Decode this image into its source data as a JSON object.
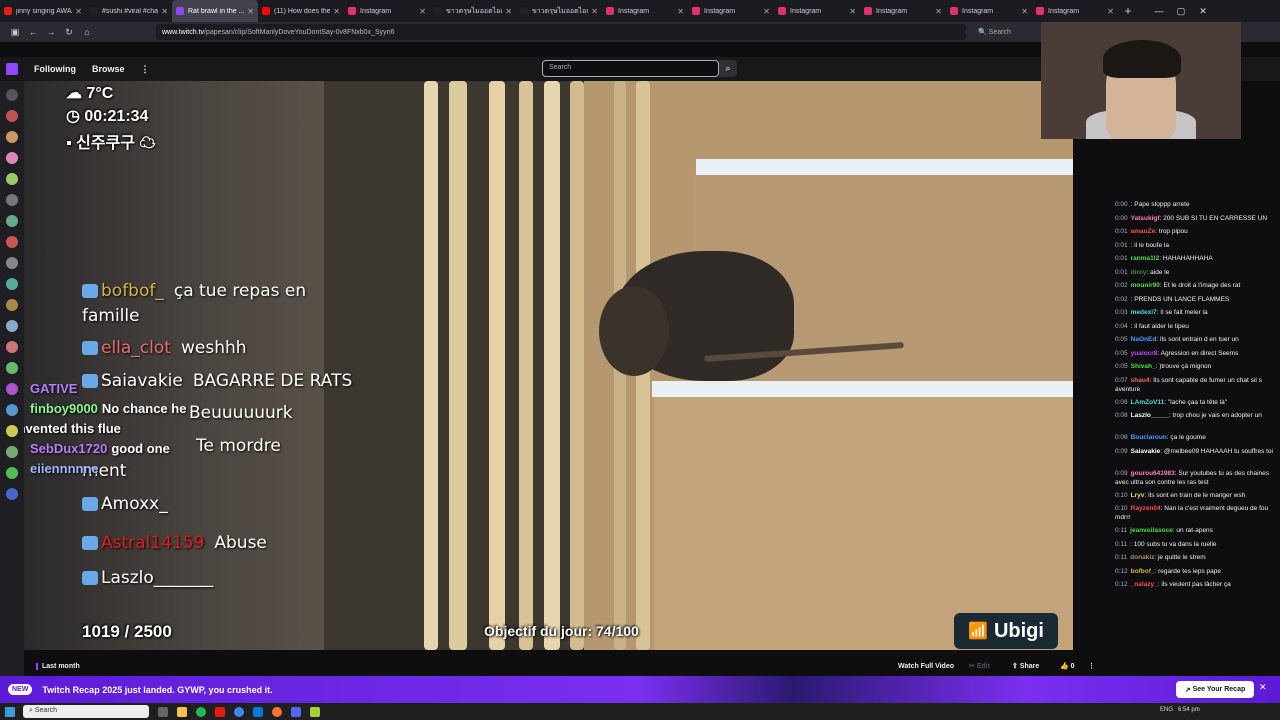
{
  "browser": {
    "tabs": [
      {
        "title": "jinny singing AWAA ...",
        "color": "#e91916",
        "active": false
      },
      {
        "title": "#sushi #viral #challen...",
        "color": "#222222",
        "active": false
      },
      {
        "title": "Rat brawl in the ...",
        "color": "#9147ff",
        "active": true
      },
      {
        "title": "(11) How does the 8...",
        "color": "#ff0000",
        "active": false
      },
      {
        "title": "Instagram",
        "color": "#e1306c",
        "active": false
      },
      {
        "title": "ขาวตรุษไมออดไอเอ ฟลอดี...",
        "color": "#222222",
        "active": false
      },
      {
        "title": "ขาวตรุษไมออดไอเอ ฟลอดี...",
        "color": "#222222",
        "active": false
      },
      {
        "title": "Instagram",
        "color": "#e1306c",
        "active": false
      },
      {
        "title": "Instagram",
        "color": "#e1306c",
        "active": false
      },
      {
        "title": "Instagram",
        "color": "#e1306c",
        "active": false
      },
      {
        "title": "Instagram",
        "color": "#e1306c",
        "active": false
      },
      {
        "title": "Instagram",
        "color": "#e1306c",
        "active": false
      },
      {
        "title": "Instagram",
        "color": "#e1306c",
        "active": false
      }
    ],
    "url_host": "www.twitch.tv",
    "url_path": "/papesan/clip/SoftManlyDoveYouDontSay-0v8FNxb0x_Syyn6",
    "search_placeholder": "Search"
  },
  "twitch": {
    "nav_following": "Following",
    "nav_browse": "Browse",
    "nav_more": "⋮",
    "search_placeholder": "Search"
  },
  "overlay": {
    "weather": "7°C",
    "time": "00:21:34",
    "location": "신주쿠구",
    "counter": "1019 / 2500",
    "goal": "Objectif du jour: 74/100",
    "sponsor": "Ubigi",
    "stream_chat": [
      {
        "user": "bofbof_",
        "msg": "ça tue repas en",
        "color": "#d4b14c"
      },
      {
        "user": "",
        "msg": "famille",
        "color": "#ffffff"
      },
      {
        "user": "ella_clot",
        "msg": "weshhh",
        "color": "#e86a6a"
      },
      {
        "user": "Saiavakie",
        "msg": "BAGARRE DE RATS",
        "color": "#ffffff"
      },
      {
        "user": "",
        "msg": "Beuuuuuurk",
        "color": "#ffffff"
      },
      {
        "user": "",
        "msg": "Te mordre",
        "color": "#ffffff"
      },
      {
        "user": "",
        "msg": "ment",
        "color": "#ffffff"
      },
      {
        "user": "Amoxx_",
        "msg": "",
        "color": "#ffffff"
      },
      {
        "user": "Astral14159",
        "msg": "Abuse",
        "color": "#e21b1b"
      },
      {
        "user": "Laszlo_______",
        "msg": "",
        "color": "#ffffff"
      }
    ],
    "left_chat": [
      {
        "user": "GATIVE",
        "msg": "",
        "color": "#b77cff"
      },
      {
        "user": "finboy9000",
        "msg": "No chance he",
        "color": "#8ef58e"
      },
      {
        "user": "",
        "msg": "invented this flue",
        "color": "#ffffff"
      },
      {
        "user": "SebDux1720",
        "msg": "good one",
        "color": "#b77cff"
      },
      {
        "user": "eiiennnnne",
        "msg": "",
        "color": "#9fb7ff"
      }
    ]
  },
  "chat": {
    "messages": [
      {
        "t": "0:00",
        "u": "",
        "m": ": Pape stoppp arrete",
        "c": "#5a5aff"
      },
      {
        "t": "0:00",
        "u": "Yatsukigf",
        "m": ": 200 SUB SI TU EN CARRESSE UN",
        "c": "#ff7fbf"
      },
      {
        "t": "0:01",
        "u": "amauZe",
        "m": ": trop pipou",
        "c": "#ff4d4d"
      },
      {
        "t": "0:01",
        "u": "",
        "m": ": il le boufe la",
        "c": "#5a5aff"
      },
      {
        "t": "0:01",
        "u": "ranma1l2",
        "m": ": HAHAHAHHAHA",
        "c": "#4ddc4d"
      },
      {
        "t": "0:01",
        "u": "diroy",
        "m": ": aide le",
        "c": "#3a8a3a"
      },
      {
        "t": "0:02",
        "u": "mounir90",
        "m": ": Et le droit a l'image des rat",
        "c": "#4ddc4d"
      },
      {
        "t": "0:02",
        "u": "",
        "m": ": PRENDS UN LANCE FLAMMES",
        "c": "#5a5aff"
      },
      {
        "t": "0:03",
        "u": "medexi7",
        "m": ": Il se fait meler la",
        "c": "#4ddcdc"
      },
      {
        "t": "0:04",
        "u": "",
        "m": ": il faut aider le tipeu",
        "c": "#ff4d4d"
      },
      {
        "t": "0:05",
        "u": "NaOnEd",
        "m": ": Ils sont entrain d en tuer un",
        "c": "#4d9cff"
      },
      {
        "t": "0:05",
        "u": "yuaiocr8",
        "m": ": Agression en direct Seems",
        "c": "#c04dff"
      },
      {
        "t": "0:05",
        "u": "Shivah_",
        "m": ": )trouve çà mignon",
        "c": "#4ddc4d"
      },
      {
        "t": "0:07",
        "u": "shau4",
        "m": ": Ils sont capable de fumer un chat sil s aventure",
        "c": "#ff6b4d"
      },
      {
        "t": "0:08",
        "u": "LAmZoV11",
        "m": ": \"lache çaa ta tête là\"",
        "c": "#4ddcdc"
      },
      {
        "t": "0:08",
        "u": "Laszlo_____",
        "m": ": trop chou je vais en adopter un",
        "c": "#ffffff"
      },
      {
        "t": "0:08",
        "u": "Bouclaroun",
        "m": ": ça le goume",
        "c": "#4d9cff"
      },
      {
        "t": "0:09",
        "u": "Saiavakie",
        "m": ": @melbee09 HAHAAAH tu souffres toi",
        "c": "#ffffff"
      },
      {
        "t": "0:09",
        "u": "gourou641983",
        "m": ": Sur youtubes tu as des chaines avec ultra son contre les ras test",
        "c": "#ff7fbf"
      },
      {
        "t": "0:10",
        "u": "Lryv",
        "m": ": Ils sont en train de le manger wsh",
        "c": "#ffd84d"
      },
      {
        "t": "0:10",
        "u": "Rayzen04",
        "m": ": Nan la c'est vraiment degueu de fou mdrrr",
        "c": "#ff4d4d"
      },
      {
        "t": "0:11",
        "u": "jeanvoilasoce",
        "m": ": un rat-apens",
        "c": "#4ddc4d"
      },
      {
        "t": "0:11",
        "u": "",
        "m": ": 100 subs tu va dans la ruelle",
        "c": "#5a5aff"
      },
      {
        "t": "0:11",
        "u": "donakiz",
        "m": ": je quitte le strem",
        "c": "#b08a6a"
      },
      {
        "t": "0:12",
        "u": "bofbof_",
        "m": ": regarde tes ieps pape",
        "c": "#d4b14c"
      },
      {
        "t": "0:12",
        "u": "_nalazy_",
        "m": ": ils veulent pas lâcher ça",
        "c": "#ff4d4d"
      }
    ]
  },
  "video_bar": {
    "last_month": "Last month",
    "watch_full": "Watch Full Video",
    "edit": "Edit",
    "share": "Share",
    "likes": "0"
  },
  "banner": {
    "badge": "NEW",
    "text": "Twitch Recap 2025 just landed. GYWP, you crushed it.",
    "button": "See Your Recap"
  },
  "taskbar": {
    "search_placeholder": "Search",
    "lang": "ENG",
    "time": "6:54 pm"
  }
}
